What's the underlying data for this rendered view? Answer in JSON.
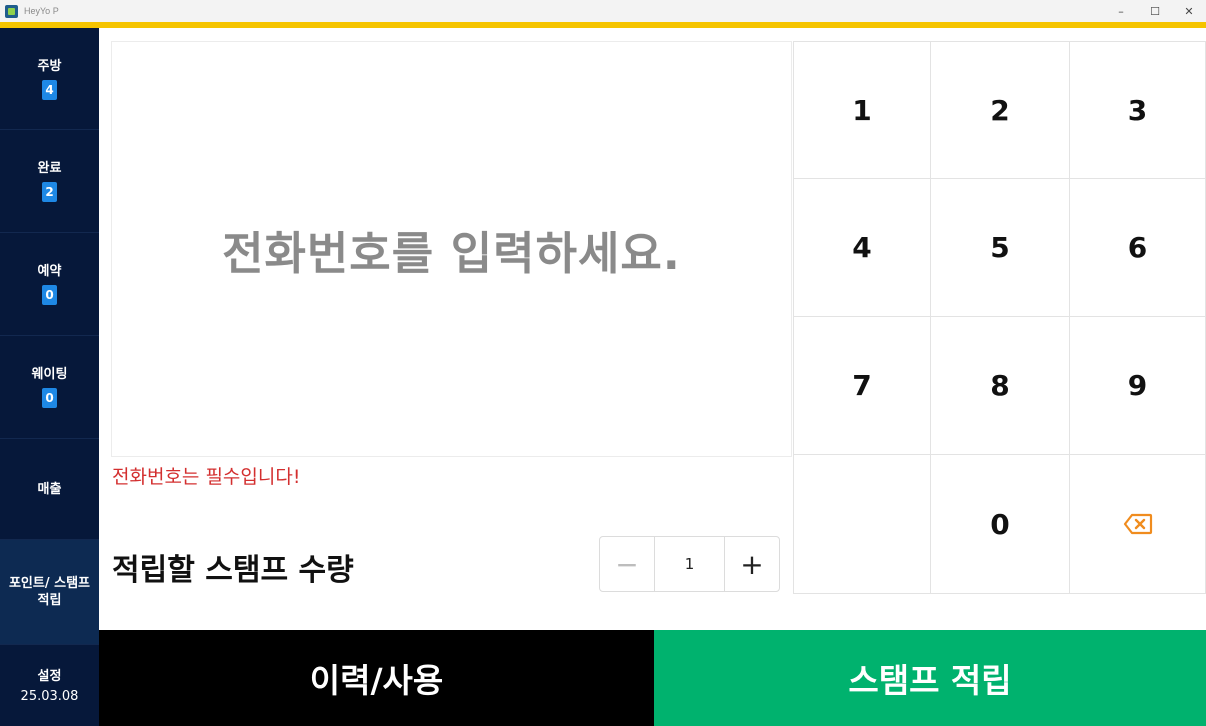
{
  "window": {
    "title": "HeyYo P",
    "controls": [
      "–",
      "☐",
      "✕"
    ]
  },
  "colors": {
    "accent": "#f5c400",
    "sidebar": "#06183a",
    "badge": "#1e88e5",
    "primary_action": "#00b26e",
    "error": "#d32f2f",
    "backspace": "#f08c1e"
  },
  "sidebar": {
    "items": [
      {
        "label": "주방",
        "badge": "4"
      },
      {
        "label": "완료",
        "badge": "2"
      },
      {
        "label": "예약",
        "badge": "0"
      },
      {
        "label": "웨이팅",
        "badge": "0"
      },
      {
        "label": "매출"
      },
      {
        "label": "포인트/ 스탬프 적립",
        "active": true
      },
      {
        "label": "설정",
        "date": "25.03.08"
      }
    ]
  },
  "phone_input": {
    "placeholder": "전화번호를 입력하세요."
  },
  "error_message": "전화번호는 필수입니다!",
  "stamp_quantity": {
    "label": "적립할 스탬프 수량",
    "minus": "−",
    "value": "1",
    "plus": "+"
  },
  "keypad": {
    "keys": [
      "1",
      "2",
      "3",
      "4",
      "5",
      "6",
      "7",
      "8",
      "9",
      "",
      "0",
      "backspace-icon"
    ]
  },
  "actions": {
    "history_label": "이력/사용",
    "stamp_label": "스탬프 적립"
  }
}
